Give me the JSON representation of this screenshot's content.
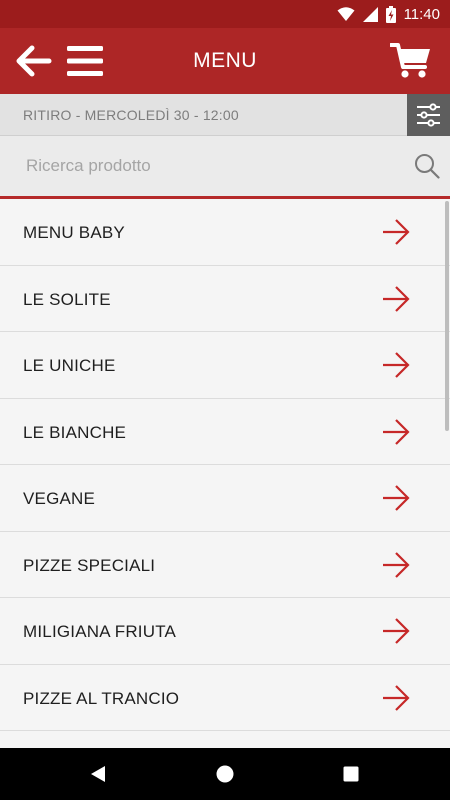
{
  "status_bar": {
    "time": "11:40",
    "icons": [
      "wifi-icon",
      "cellular-signal-icon",
      "battery-charging-icon"
    ]
  },
  "app_bar": {
    "title": "MENU",
    "icons": [
      "back-arrow-icon",
      "hamburger-menu-icon",
      "cart-icon"
    ]
  },
  "pickup": {
    "text": "RITIRO - MERCOLEDÌ 30 - 12:00",
    "filter_icon": "sliders-icon"
  },
  "search": {
    "placeholder": "Ricerca prodotto",
    "value": "",
    "icon": "search-icon"
  },
  "menu": {
    "items": [
      {
        "label": "MENU BABY"
      },
      {
        "label": "LE SOLITE"
      },
      {
        "label": "LE UNICHE"
      },
      {
        "label": "LE BIANCHE"
      },
      {
        "label": "VEGANE"
      },
      {
        "label": "PIZZE SPECIALI"
      },
      {
        "label": "MILIGIANA FRIUTA"
      },
      {
        "label": "PIZZE AL TRANCIO"
      }
    ],
    "item_icon": "arrow-right-icon"
  },
  "nav_bar": {
    "buttons": [
      "back-triangle-icon",
      "home-circle-icon",
      "recents-square-icon"
    ]
  },
  "colors": {
    "primary": "#ad2626",
    "status_bar": "#9c1c1c",
    "accent_arrow": "#c62828",
    "filter_button": "#5e5e5e",
    "pickup_bar": "#e2e2e2"
  }
}
